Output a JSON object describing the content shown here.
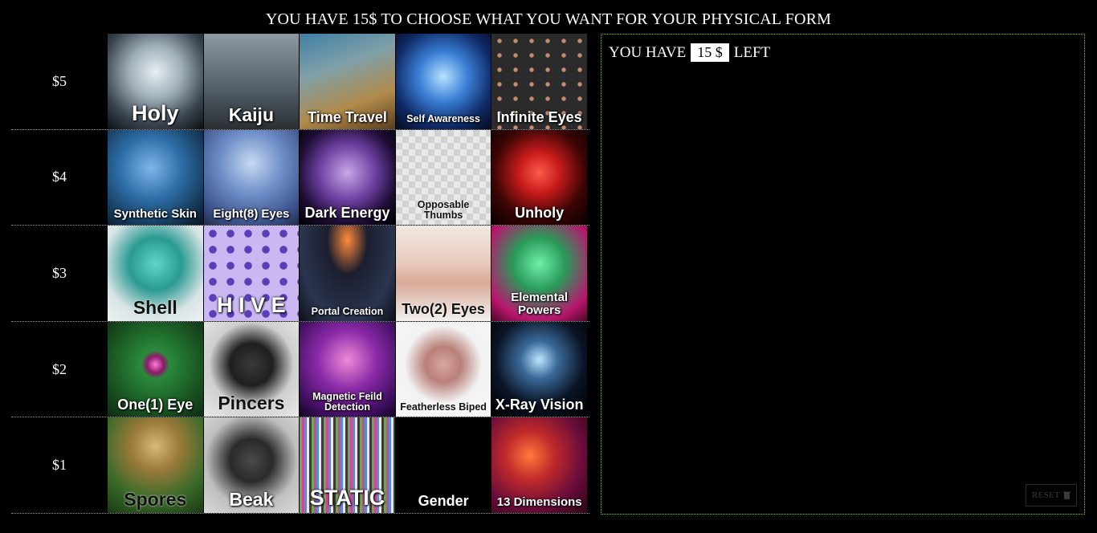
{
  "page": {
    "title": "YOU HAVE 15$ TO CHOOSE WHAT YOU WANT FOR YOUR PHYSICAL FORM"
  },
  "tiers": [
    {
      "label": "$5",
      "items": [
        {
          "label": "Holy",
          "icon": "holy-icon",
          "size": "fs-big",
          "art": "radial-gradient(circle at 50% 40%, #e8eef2 0%, #9fb0bb 35%, #3a4550 70%, #0c0f12 100%)"
        },
        {
          "label": "Kaiju",
          "icon": "kaiju-icon",
          "size": "fs-lg",
          "art": "linear-gradient(180deg, #8d9aa4 0%, #5a6670 50%, #2a2f34 100%)"
        },
        {
          "label": "Time Travel",
          "icon": "time-travel-icon",
          "size": "fs-md",
          "art": "linear-gradient(160deg, #3f7fa6 0%, #7fa0a8 35%, #b08a4a 70%, #5a3d1e 100%)"
        },
        {
          "label": "Self Awareness",
          "icon": "brain-icon",
          "size": "fs-xs",
          "art": "radial-gradient(circle at 50% 45%, #b6e2ff 0%, #3a7fd6 35%, #0f2a66 70%, #050a1f 100%)"
        },
        {
          "label": "Infinite Eyes",
          "icon": "eyes-icon",
          "size": "fs-md",
          "art": "radial-gradient(circle, #c58a72 18%, #2b2b2b 22%) 0 0/20px 18px, #3a2a24"
        }
      ]
    },
    {
      "label": "$4",
      "items": [
        {
          "label": "Synthetic Skin",
          "icon": "synthetic-skin-icon",
          "size": "fs-sm",
          "art": "radial-gradient(circle at 45% 40%, #7fb6e8 0%, #2e6ea8 40%, #12324d 80%, #0a1620 100%)"
        },
        {
          "label": "Eight(8) Eyes",
          "icon": "spider-eyes-icon",
          "size": "fs-sm",
          "art": "radial-gradient(circle at 50% 35%, #c8d9f2 0%, #6f8fc8 40%, #3a4f88 80%, #222b4a 100%)"
        },
        {
          "label": "Dark Energy",
          "icon": "dark-energy-icon",
          "size": "fs-md",
          "art": "radial-gradient(circle at 50% 45%, #c9a7e8 0%, #6c3fa0 40%, #1e0d35 70%, #000 100%)"
        },
        {
          "label": "Opposable Thumbs",
          "icon": "thumbs-up-icon",
          "size": "fs-xs",
          "art": "repeating-conic-gradient(#e9e9e9 0% 25%, #d2d2d2 0% 50%) 0 0/16px 16px",
          "dark": true
        },
        {
          "label": "Unholy",
          "icon": "pentagram-icon",
          "size": "fs-md",
          "art": "radial-gradient(circle at 50% 45%, #ff5a4a 0%, #c41a1a 30%, #3a0505 65%, #0a0000 100%)"
        }
      ]
    },
    {
      "label": "$3",
      "items": [
        {
          "label": "Shell",
          "icon": "crab-icon",
          "size": "fs-lg",
          "art": "radial-gradient(circle at 50% 40%, #5fd6c8 0%, #2a9a92 35%, #d8e4e6 70%, #eef2f2 100%)",
          "dark": true
        },
        {
          "label": "H I V E",
          "icon": "hive-icon",
          "size": "fs-big",
          "art": "radial-gradient(circle, #5a3fb8 30%, #cbb8f2 34%) 0 0/22px 20px, #9a7ad6"
        },
        {
          "label": "Portal Creation",
          "icon": "portal-icon",
          "size": "fs-xs",
          "art": "radial-gradient(ellipse at 50% 15%, #ff8a3a 0%, #1c1e2e 30%, #2a3550 70%, #0d1018 100%)"
        },
        {
          "label": "Two(2) Eyes",
          "icon": "two-eyes-icon",
          "size": "fs-md",
          "art": "linear-gradient(180deg, #f0e8e2 0%, #e8c9bb 40%, #d8aa98 60%, #f3f0ee 100%)",
          "dark": true
        },
        {
          "label": "Elemental Powers",
          "icon": "elemental-icon",
          "size": "fs-sm",
          "art": "radial-gradient(circle at 50% 40%, #6ff0a8 0%, #2a9a5a 35%, #b8166e 75%, #4a0826 100%)"
        }
      ]
    },
    {
      "label": "$2",
      "items": [
        {
          "label": "One(1) Eye",
          "icon": "one-eye-icon",
          "size": "fs-md",
          "art": "radial-gradient(circle at 50% 45%, #ff7ad8 0%, #8a1a6a 12%, #2a8a3a 20%, #1b5a25 60%, #0e2a12 100%)"
        },
        {
          "label": "Pincers",
          "icon": "beetle-icon",
          "size": "fs-lg",
          "art": "radial-gradient(circle at 50% 45%, #3a3a3a 0%, #1f1f1f 30%, #cfcfcf 60%, #e8e8e8 100%)",
          "dark": true
        },
        {
          "label": "Magnetic Feild Detection",
          "icon": "magnet-icon",
          "size": "fs-xs",
          "art": "radial-gradient(circle at 50% 40%, #f08ad6 0%, #8a2aa8 40%, #3a0d5a 80%, #12041f 100%)"
        },
        {
          "label": "Featherless Biped",
          "icon": "chicken-icon",
          "size": "fs-xs",
          "art": "radial-gradient(circle at 50% 45%, #d8a8a0 0%, #b88078 25%, #f2f2f2 55%, #f8f8f8 100%)",
          "dark": true
        },
        {
          "label": "X-Ray Vision",
          "icon": "xray-icon",
          "size": "fs-md",
          "art": "radial-gradient(circle at 50% 40%, #bfe6ff 0%, #3a6a9a 25%, #0a1424 60%, #000 100%)"
        }
      ]
    },
    {
      "label": "$1",
      "items": [
        {
          "label": "Spores",
          "icon": "mushroom-icon",
          "size": "fs-lg",
          "art": "radial-gradient(circle at 50% 30%, #d8b878 0%, #9a7a3a 30%, #3a6a2a 65%, #1a3a12 100%)",
          "dark": true
        },
        {
          "label": "Beak",
          "icon": "beak-icon",
          "size": "fs-lg",
          "art": "radial-gradient(circle at 50% 45%, #4a4a4a 0%, #2a2a2a 30%, #bfbfbf 65%, #dadada 100%)"
        },
        {
          "label": "STATIC",
          "icon": "static-icon",
          "size": "fs-big",
          "art": "repeating-linear-gradient(90deg, #7aa05a 0 3px, #c84a9a 3px 6px, #5a8ad6 6px 9px, #e8e8e8 9px 12px, #3a3a3a 12px 15px)"
        },
        {
          "label": "Gender",
          "icon": "gender-symbol-icon",
          "size": "fs-md",
          "art": "#000"
        },
        {
          "label": "13 Dimensions",
          "icon": "dimensions-icon",
          "size": "fs-sm",
          "art": "radial-gradient(circle at 40% 40%, #ff7a3a 0%, #c02a2a 30%, #6a0d3a 65%, #2a0514 100%)"
        }
      ]
    }
  ],
  "panel": {
    "budget_prefix": "YOU HAVE",
    "budget_value": "15 $",
    "budget_suffix": "LEFT",
    "reset_label": "RESET"
  },
  "colors": {
    "background": "#000000",
    "panel_border": "#6fbf3a"
  }
}
